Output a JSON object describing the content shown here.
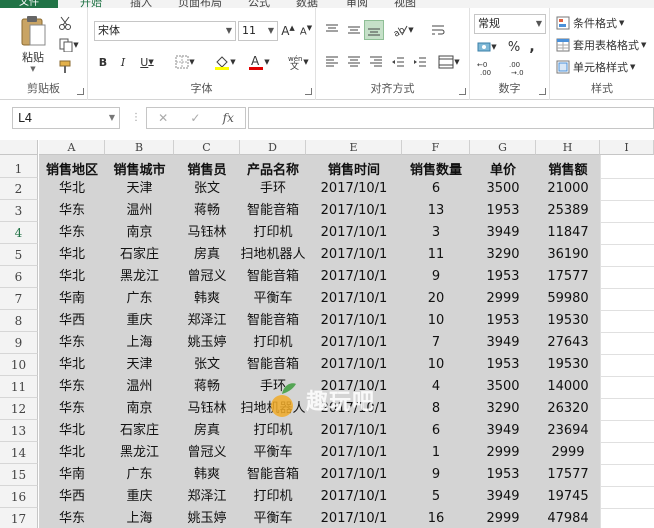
{
  "ribbon_tabs": [
    "文件",
    "开始",
    "插入",
    "页面布局",
    "公式",
    "数据",
    "审阅",
    "视图"
  ],
  "clipboard": {
    "paste_label": "粘贴",
    "group_label": "剪贴板"
  },
  "font": {
    "name": "宋体",
    "size": "11",
    "group_label": "字体"
  },
  "alignment": {
    "group_label": "对齐方式"
  },
  "number": {
    "format": "常规",
    "group_label": "数字",
    "percent": "%"
  },
  "styles": {
    "conditional": "条件格式",
    "table_format": "套用表格格式",
    "cell_styles": "单元格样式",
    "group_label": "样式"
  },
  "formula_bar": {
    "cell_ref": "L4",
    "fx": "fx"
  },
  "watermark": "趣玩吧",
  "columns": [
    "A",
    "B",
    "C",
    "D",
    "E",
    "F",
    "G",
    "H",
    "I"
  ],
  "selected_row": 4,
  "table": {
    "headers": [
      "销售地区",
      "销售城市",
      "销售员",
      "产品名称",
      "销售时间",
      "销售数量",
      "单价",
      "销售额"
    ],
    "rows": [
      [
        "华北",
        "天津",
        "张文",
        "手环",
        "2017/10/1",
        "6",
        "3500",
        "21000"
      ],
      [
        "华东",
        "温州",
        "蒋畅",
        "智能音箱",
        "2017/10/1",
        "13",
        "1953",
        "25389"
      ],
      [
        "华东",
        "南京",
        "马钰林",
        "打印机",
        "2017/10/1",
        "3",
        "3949",
        "11847"
      ],
      [
        "华北",
        "石家庄",
        "房真",
        "扫地机器人",
        "2017/10/1",
        "11",
        "3290",
        "36190"
      ],
      [
        "华北",
        "黑龙江",
        "曾冠义",
        "智能音箱",
        "2017/10/1",
        "9",
        "1953",
        "17577"
      ],
      [
        "华南",
        "广东",
        "韩爽",
        "平衡车",
        "2017/10/1",
        "20",
        "2999",
        "59980"
      ],
      [
        "华西",
        "重庆",
        "郑泽江",
        "智能音箱",
        "2017/10/1",
        "10",
        "1953",
        "19530"
      ],
      [
        "华东",
        "上海",
        "姚玉婷",
        "打印机",
        "2017/10/1",
        "7",
        "3949",
        "27643"
      ],
      [
        "华北",
        "天津",
        "张文",
        "智能音箱",
        "2017/10/1",
        "10",
        "1953",
        "19530"
      ],
      [
        "华东",
        "温州",
        "蒋畅",
        "手环",
        "2017/10/1",
        "4",
        "3500",
        "14000"
      ],
      [
        "华东",
        "南京",
        "马钰林",
        "扫地机器人",
        "2017/10/1",
        "8",
        "3290",
        "26320"
      ],
      [
        "华北",
        "石家庄",
        "房真",
        "打印机",
        "2017/10/1",
        "6",
        "3949",
        "23694"
      ],
      [
        "华北",
        "黑龙江",
        "曾冠义",
        "平衡车",
        "2017/10/1",
        "1",
        "2999",
        "2999"
      ],
      [
        "华南",
        "广东",
        "韩爽",
        "智能音箱",
        "2017/10/1",
        "9",
        "1953",
        "17577"
      ],
      [
        "华西",
        "重庆",
        "郑泽江",
        "打印机",
        "2017/10/1",
        "5",
        "3949",
        "19745"
      ],
      [
        "华东",
        "上海",
        "姚玉婷",
        "平衡车",
        "2017/10/1",
        "16",
        "2999",
        "47984"
      ]
    ]
  },
  "colors": {
    "accent": "#217346",
    "data_fill": "#d4d4d4"
  }
}
